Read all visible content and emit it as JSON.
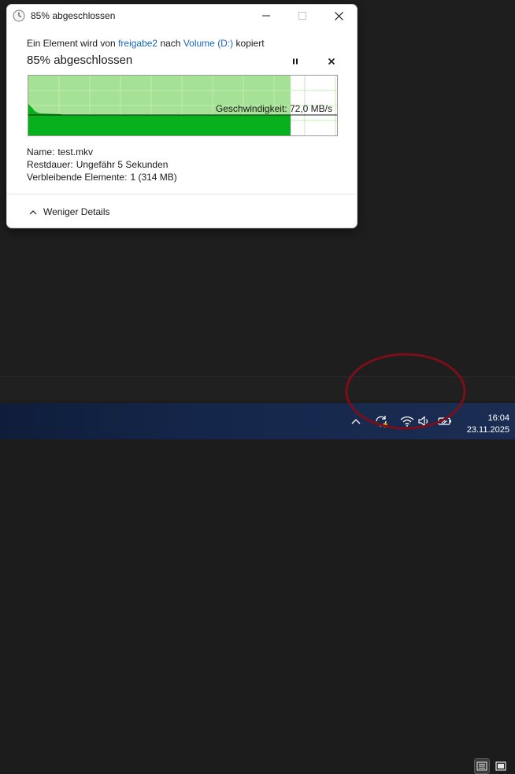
{
  "dialog": {
    "title": "85% abgeschlossen",
    "copy_prefix": "Ein Element wird von",
    "source": "freigabe2",
    "copy_middle": "nach",
    "destination": "Volume (D:)",
    "copy_suffix": "kopiert",
    "heading": "85% abgeschlossen",
    "progress_fraction": 0.85,
    "speed_label": "Geschwindigkeit:",
    "speed_value": "72,0 MB/s",
    "details": {
      "name_label": "Name:",
      "name_value": "test.mkv",
      "remaining_label": "Restdauer:",
      "remaining_value": "Ungefähr 5 Sekunden",
      "items_label": "Verbleibende Elemente:",
      "items_value": "1 (314 MB)"
    },
    "less_details": "Weniger Details",
    "colors": {
      "progress_light": "#a6e296",
      "progress_dark": "#07b11e",
      "link": "#1565c0"
    }
  },
  "taskbar": {
    "time": "16:04",
    "date": "23.11.2025"
  },
  "annotation": {
    "color": "#7a0f1a"
  }
}
